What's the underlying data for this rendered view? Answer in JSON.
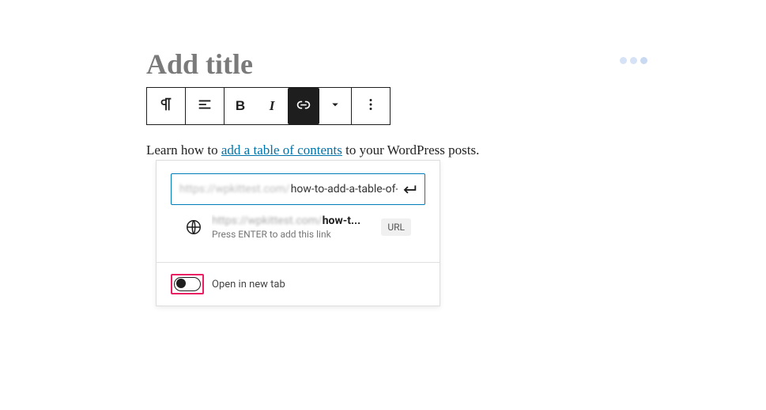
{
  "title_placeholder": "Add title",
  "toolbar": {
    "paragraph": "paragraph",
    "align": "align",
    "bold": "B",
    "italic": "I",
    "link": "link",
    "more_rich": "more",
    "options": "options"
  },
  "content": {
    "before": "Learn how to ",
    "link_text": "add a table of contents",
    "after": " to your WordPress posts."
  },
  "link_popover": {
    "input_prefix": "https://wpkittest.com/",
    "input_value": "how-to-add-a-table-of-c",
    "suggestion_prefix": "https://wpkittest.com/",
    "suggestion_bold": "how-t...",
    "suggestion_hint": "Press ENTER to add this link",
    "url_badge": "URL",
    "toggle_label": "Open in new tab",
    "toggle_on": false
  },
  "dots_colors": [
    "#d6e2f5",
    "#d6e2f5",
    "#c9d9f2"
  ]
}
